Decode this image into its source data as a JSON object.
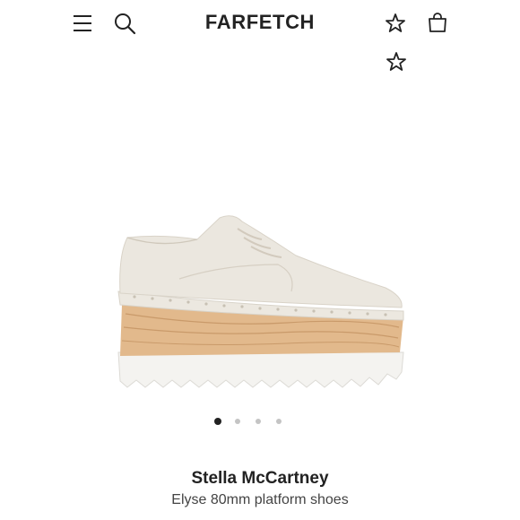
{
  "header": {
    "logo_text": "FARFETCH",
    "icons": {
      "menu": "hamburger-menu-icon",
      "search": "search-icon",
      "wishlist": "star-outline-icon",
      "bag": "shopping-bag-icon",
      "favourite": "star-outline-icon"
    }
  },
  "product": {
    "brand": "Stella McCartney",
    "name": "Elyse 80mm platform shoes",
    "image": {
      "description_icon": "shoe-image"
    }
  },
  "carousel": {
    "total_slides": 4,
    "active_index": 0
  },
  "colors": {
    "text": "#222222",
    "dot_inactive": "#c4c4c4",
    "dot_active": "#222222"
  }
}
